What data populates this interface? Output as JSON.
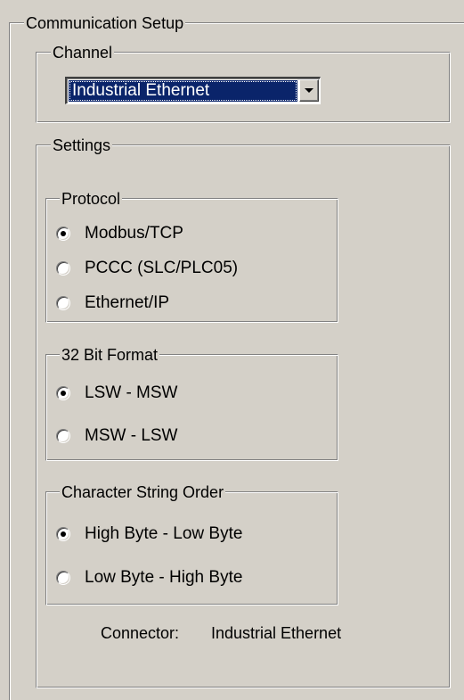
{
  "communication_setup": {
    "title": "Communication Setup"
  },
  "channel": {
    "title": "Channel",
    "selected": "Industrial Ethernet"
  },
  "settings": {
    "title": "Settings"
  },
  "protocol": {
    "title": "Protocol",
    "options": [
      {
        "label": "Modbus/TCP",
        "checked": true
      },
      {
        "label": "PCCC (SLC/PLC05)",
        "checked": false
      },
      {
        "label": "Ethernet/IP",
        "checked": false
      }
    ]
  },
  "bit_format": {
    "title": "32 Bit Format",
    "options": [
      {
        "label": "LSW - MSW",
        "checked": true
      },
      {
        "label": "MSW - LSW",
        "checked": false
      }
    ]
  },
  "string_order": {
    "title": "Character String Order",
    "options": [
      {
        "label": "High Byte - Low Byte",
        "checked": true
      },
      {
        "label": "Low Byte - High Byte",
        "checked": false
      }
    ]
  },
  "connector": {
    "label": "Connector:",
    "value": "Industrial Ethernet"
  },
  "colors": {
    "window_bg": "#d4d0c8",
    "selection_bg": "#0a246a",
    "selection_text": "#ffffff"
  }
}
